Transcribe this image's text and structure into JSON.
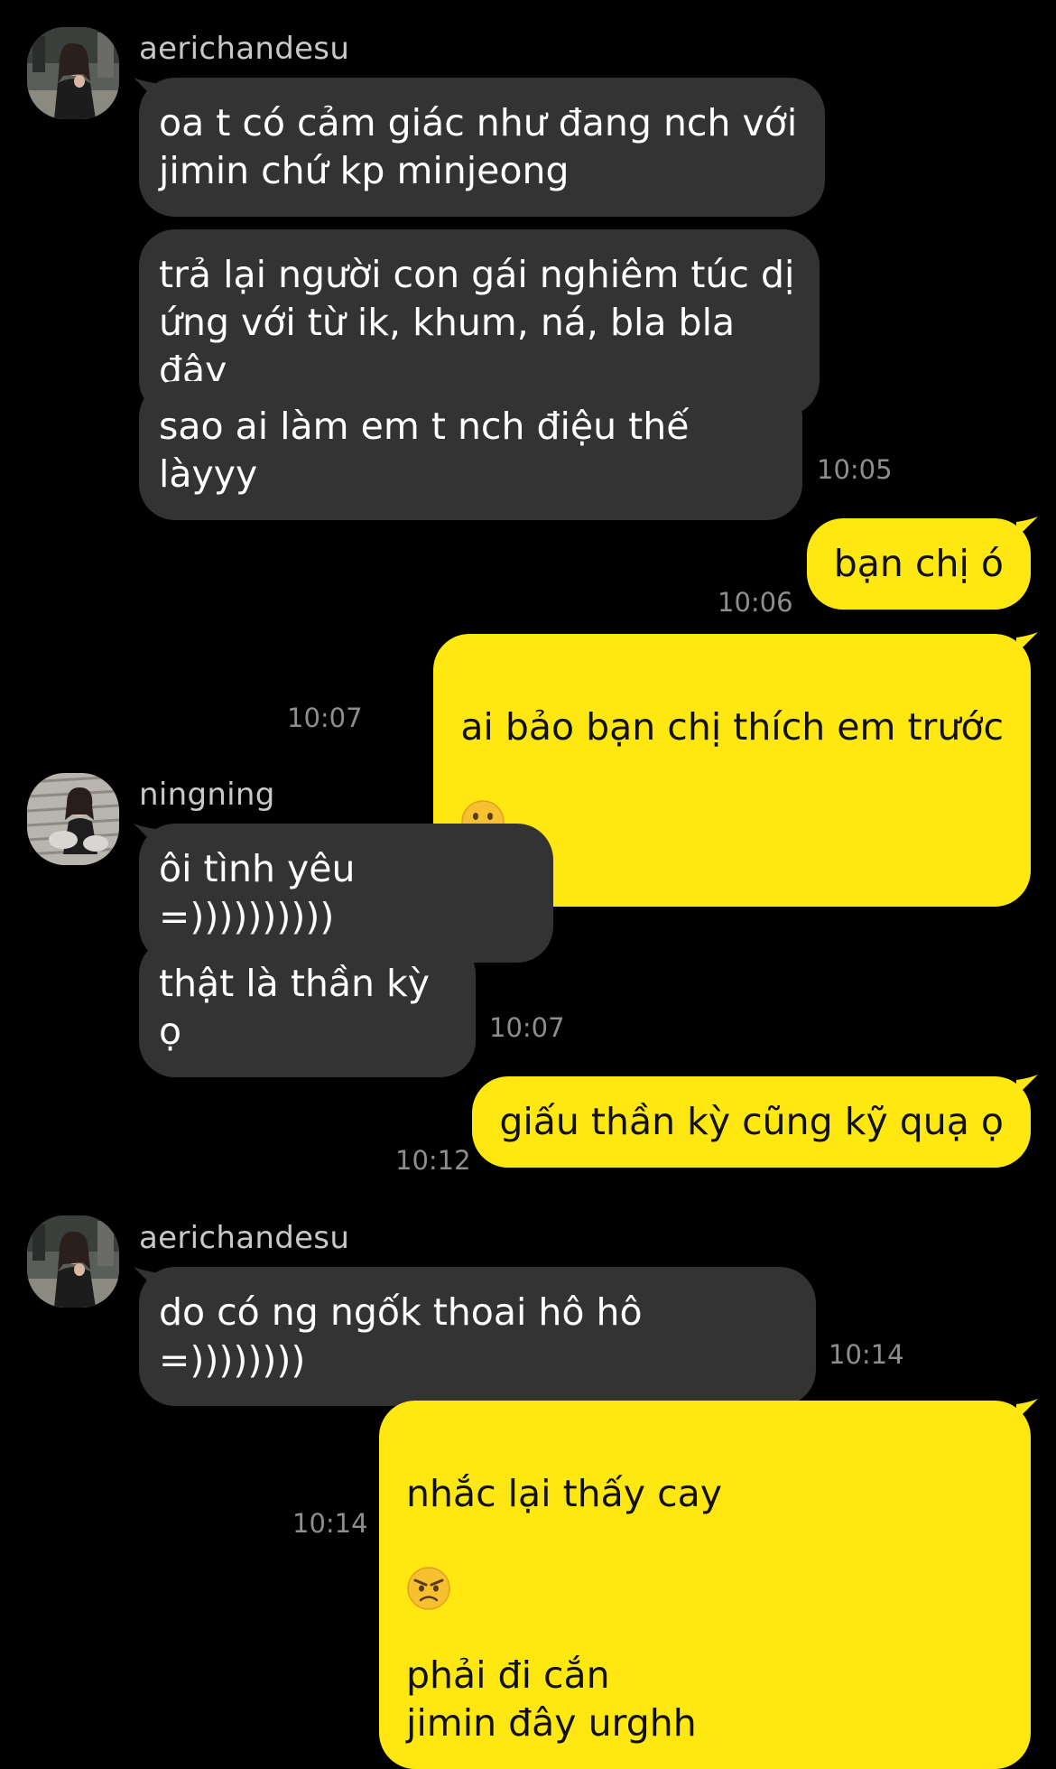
{
  "colors": {
    "background": "#000000",
    "incoming_bubble": "#333333",
    "outgoing_bubble": "#ffe812",
    "timestamp": "#8e8e8e",
    "sender_name": "#c8c8c8"
  },
  "groups": [
    {
      "sender": "aerichandesu",
      "avatar": "avatar-aerichandesu",
      "messages": [
        "oa t có cảm giác như đang nch với\njimin chứ kp minjeong",
        "trả lại người con gái nghiêm túc dị\nứng với từ ik, khum, ná, bla bla đây",
        "sao ai làm em t nch điệu thế làyyy"
      ],
      "time": "10:05"
    },
    {
      "sender": "me",
      "messages": [
        "bạn chị ó"
      ],
      "time": "10:06"
    },
    {
      "sender": "me",
      "messages": [
        "ai bảo bạn chị thích em trước"
      ],
      "emoji": "face-with-tongue-icon",
      "time": "10:07"
    },
    {
      "sender": "ningning",
      "avatar": "avatar-ningning",
      "messages": [
        "ôi tình yêu =))))))))))",
        "thật là thần kỳ ọ"
      ],
      "time": "10:07"
    },
    {
      "sender": "me",
      "messages": [
        "giấu thần kỳ cũng kỹ quạ ọ"
      ],
      "time": "10:12"
    },
    {
      "sender": "aerichandesu",
      "avatar": "avatar-aerichandesu",
      "messages": [
        "do có ng ngốk thoai hô hô =))))))))"
      ],
      "time": "10:14"
    },
    {
      "sender": "me",
      "messages": [
        "nhắc lại thấy cay",
        "phải đi cắn\njimin đây urghh"
      ],
      "emoji": "angry-face-icon",
      "time": "10:14"
    }
  ]
}
